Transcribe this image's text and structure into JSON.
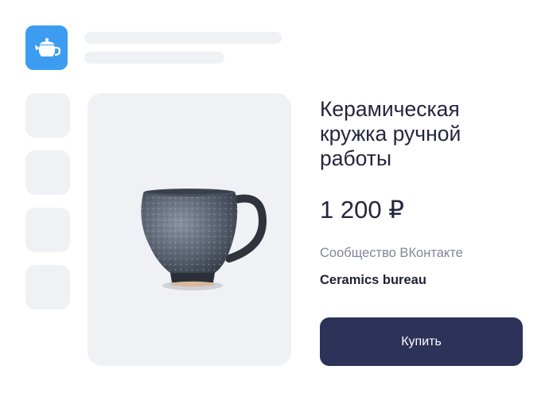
{
  "app": {
    "icon": "teapot-icon",
    "accent_color": "#3c9df0"
  },
  "product": {
    "title": "Керамическая кружка ручной работы",
    "price": "1 200 ₽",
    "source": "Сообщество ВКонтакте",
    "seller": "Ceramics bureau",
    "image": "mug-photo"
  },
  "actions": {
    "buy_label": "Купить",
    "buy_color": "#2d3259"
  }
}
